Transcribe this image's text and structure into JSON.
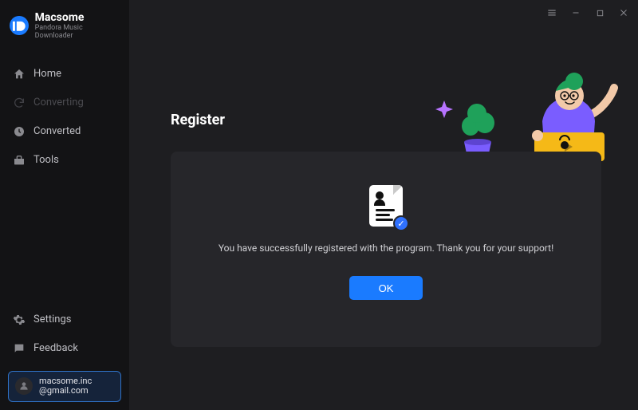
{
  "brand": {
    "name": "Macsome",
    "subtitle": "Pandora Music Downloader"
  },
  "nav": {
    "home": "Home",
    "converting": "Converting",
    "converted": "Converted",
    "tools": "Tools",
    "settings": "Settings",
    "feedback": "Feedback"
  },
  "account": {
    "line1": "macsome.inc",
    "line2": "@gmail.com"
  },
  "main": {
    "heading": "Register",
    "message": "You have successfully registered with the program. Thank you for your support!",
    "ok_label": "OK"
  },
  "colors": {
    "accent": "#1a7bff"
  }
}
